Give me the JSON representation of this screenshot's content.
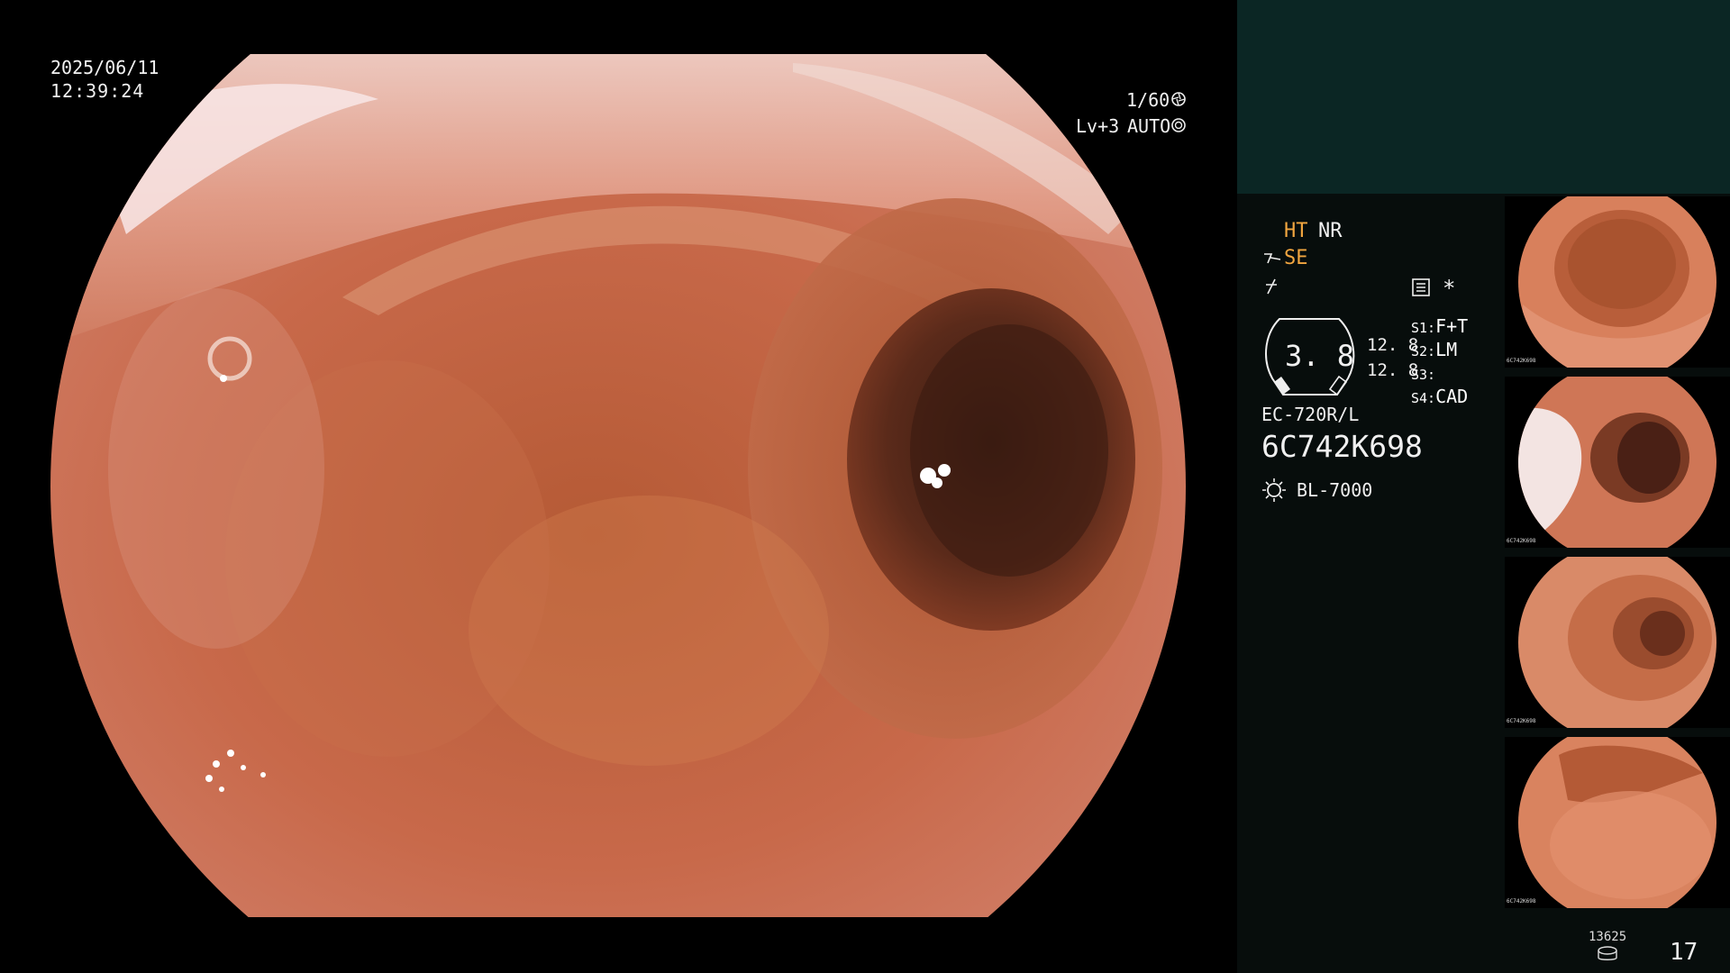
{
  "osd": {
    "date": "2025/06/11",
    "time": "12:39:24",
    "shutter": "1/60",
    "shutter_icon": "aperture-icon",
    "light_level": "Lv+3",
    "iris_mode": "AUTO",
    "iris_icon": "iris-icon"
  },
  "panel": {
    "ht": "HT",
    "nr": "NR",
    "se": "SE",
    "se_icon": "scope-enhance-icon",
    "freeze_icon": "freeze-icon",
    "memo_icon": "memo-icon",
    "star": "*",
    "magnification": "3. 8",
    "ratio_1": "12. 8",
    "ratio_2": "12. 8",
    "switches": [
      {
        "key": "S1:",
        "value": "F+T"
      },
      {
        "key": "S2:",
        "value": "LM"
      },
      {
        "key": "S3:",
        "value": ""
      },
      {
        "key": "S4:",
        "value": "CAD"
      }
    ],
    "scope_model": "EC-720R/L",
    "scope_serial": "6C742K698",
    "light_icon": "light-source-icon",
    "light_source": "BL-7000",
    "storage_count": "13625",
    "storage_icon": "storage-icon",
    "image_count": "17"
  },
  "thumbnails": [
    {
      "label": "6C742K698"
    },
    {
      "label": "6C742K698"
    },
    {
      "label": "6C742K698"
    },
    {
      "label": "6C742K698"
    }
  ],
  "colors": {
    "panel_top": "#0b2624",
    "panel_body": "#070d0c",
    "accent_orange": "#f2a640"
  }
}
